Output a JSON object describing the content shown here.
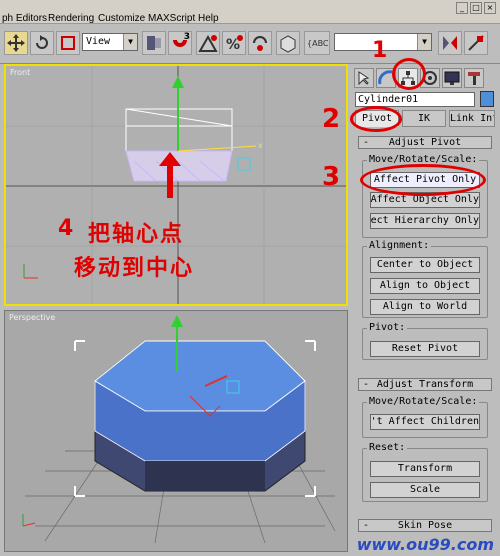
{
  "menu": {
    "items": [
      "ph Editors",
      "Rendering",
      "Customize",
      "MAXScript",
      "Help"
    ],
    "window_buttons": [
      "_",
      "□",
      "×"
    ]
  },
  "toolbar": {
    "ref_coord_value": "View",
    "snap_label": "3",
    "named_selection_value": ""
  },
  "viewports": {
    "front_label": "Front",
    "perspective_label": "Perspective"
  },
  "command_panel": {
    "object_name": "Cylinder01",
    "object_color": "#4d8fd9",
    "hierarchy_tabs": [
      "Pivot",
      "IK",
      "Link Inf"
    ],
    "adjust_pivot": {
      "title": "Adjust Pivot",
      "move_group_label": "Move/Rotate/Scale:",
      "move_buttons": [
        "Affect Pivot Only",
        "Affect Object Only",
        "Affect Hierarchy Only"
      ],
      "alignment_label": "Alignment:",
      "alignment_buttons": [
        "Center to Object",
        "Align to Object",
        "Align to World"
      ],
      "pivot_label": "Pivot:",
      "reset_pivot": "Reset Pivot"
    },
    "adjust_transform": {
      "title": "Adjust Transform",
      "move_group_label": "Move/Rotate/Scale:",
      "dont_affect": "Don't Affect Children",
      "reset_label": "Reset:",
      "transform": "Transform",
      "scale": "Scale"
    },
    "skin_pose": {
      "title": "Skin Pose"
    }
  },
  "annotations": {
    "step1": "1",
    "step2": "2",
    "step3": "3",
    "step4_num": "4",
    "step4_line1": "把轴心点",
    "step4_line2": "移动到中心",
    "color": "#e00000"
  },
  "watermark": "www.ou99.com"
}
